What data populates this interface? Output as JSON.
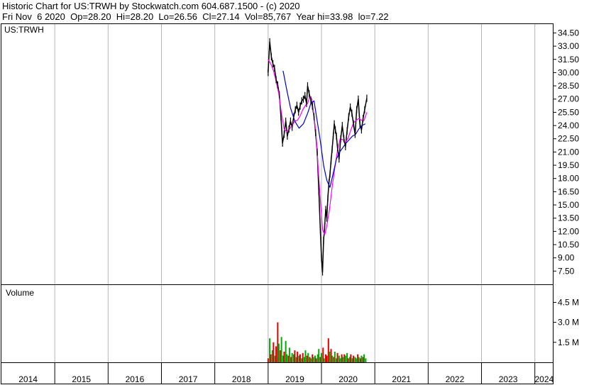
{
  "header": {
    "line1": "Historic Chart for US:TRWH by Stockwatch.com 604.687.1500 - (c) 2020",
    "line2": "Fri Nov  6 2020  Op=28.20  Hi=28.20  Lo=26.56  Cl=27.14  Vol=85,767  Year hi=33.98  lo=7.22"
  },
  "chart_data": {
    "type": "line",
    "symbol_label": "US:TRWH",
    "volume_label": "Volume",
    "price_axis": {
      "ticks": [
        "34.50",
        "33.00",
        "31.50",
        "30.00",
        "28.50",
        "27.00",
        "25.50",
        "24.00",
        "22.50",
        "21.00",
        "19.50",
        "18.00",
        "16.50",
        "15.00",
        "13.50",
        "12.00",
        "10.50",
        "9.00",
        "7.50"
      ],
      "range": [
        6.0,
        35.5
      ]
    },
    "volume_axis": {
      "ticks": [
        "4.5 M",
        "3.0 M",
        "1.5 M"
      ],
      "tick_values": [
        4.5,
        3.0,
        1.5
      ],
      "range": [
        0,
        5.8
      ]
    },
    "x_axis": {
      "years": [
        "2014",
        "2015",
        "2016",
        "2017",
        "2018",
        "2019",
        "2020",
        "2021",
        "2022",
        "2023",
        "2024"
      ],
      "range": [
        2014.0,
        2024.35
      ]
    },
    "colors": {
      "price": "#000000",
      "ma_short": "#ff00ff",
      "ma_long": "#0000cc",
      "vol_up": "#00aa00",
      "vol_down": "#dd0000",
      "frame": "#000000",
      "grid": "#b4b4b4"
    },
    "series": [
      {
        "x": [
          2019.0,
          2019.03,
          2019.06,
          2019.09,
          2019.12,
          2019.15,
          2019.18,
          2019.21,
          2019.24,
          2019.27,
          2019.3,
          2019.33,
          2019.36,
          2019.39,
          2019.42,
          2019.45,
          2019.48,
          2019.51,
          2019.54,
          2019.57,
          2019.6,
          2019.63,
          2019.66,
          2019.69,
          2019.72,
          2019.74,
          2019.77,
          2019.8,
          2019.83,
          2019.86,
          2019.89,
          2019.92,
          2019.95,
          2019.98,
          2020.0,
          2020.02,
          2020.04,
          2020.06,
          2020.08,
          2020.1,
          2020.12,
          2020.14,
          2020.16,
          2020.18,
          2020.2,
          2020.22,
          2020.24,
          2020.26,
          2020.28,
          2020.3,
          2020.33,
          2020.36,
          2020.39,
          2020.42,
          2020.45,
          2020.48,
          2020.51,
          2020.54,
          2020.57,
          2020.6,
          2020.63,
          2020.66,
          2020.69,
          2020.72,
          2020.75,
          2020.78,
          2020.81,
          2020.85
        ],
        "y": [
          30.0,
          33.5,
          31.8,
          31.0,
          30.5,
          29.2,
          28.6,
          27.5,
          25.0,
          22.0,
          23.0,
          24.5,
          22.8,
          23.6,
          24.5,
          23.8,
          25.0,
          25.8,
          26.3,
          25.5,
          26.2,
          26.8,
          27.0,
          27.4,
          26.5,
          28.5,
          27.6,
          26.9,
          26.2,
          25.0,
          23.2,
          21.0,
          16.5,
          12.0,
          9.0,
          7.4,
          11.0,
          12.5,
          14.5,
          13.5,
          15.8,
          17.5,
          18.5,
          20.0,
          21.3,
          22.8,
          24.2,
          23.5,
          22.8,
          21.5,
          20.2,
          22.5,
          24.0,
          22.5,
          21.6,
          23.4,
          25.0,
          26.1,
          25.4,
          24.2,
          23.0,
          25.8,
          27.0,
          24.2,
          23.5,
          24.8,
          25.8,
          27.1
        ]
      },
      {
        "name": "",
        "x": [
          2019.0,
          2019.05,
          2019.1,
          2019.15,
          2019.2,
          2019.25,
          2019.3,
          2019.35,
          2019.4,
          2019.45,
          2019.5,
          2019.55,
          2019.6,
          2019.65,
          2019.7,
          2019.74,
          2019.78,
          2019.82,
          2019.86,
          2019.9,
          2019.94,
          2019.98,
          2020.02,
          2020.06,
          2020.1,
          2020.15,
          2020.2,
          2020.25,
          2020.3,
          2020.35,
          2020.4,
          2020.45,
          2020.5,
          2020.55,
          2020.6,
          2020.65,
          2020.7,
          2020.75,
          2020.8,
          2020.85
        ],
        "y": [
          31.5,
          31.0,
          30.2,
          29.0,
          27.6,
          25.4,
          23.6,
          23.3,
          23.6,
          24.0,
          24.5,
          24.6,
          25.1,
          25.8,
          26.3,
          26.5,
          27.3,
          27.0,
          25.0,
          22.8,
          19.0,
          15.5,
          12.2,
          11.6,
          12.6,
          14.5,
          17.0,
          19.2,
          21.2,
          22.5,
          22.4,
          22.1,
          22.6,
          23.5,
          24.3,
          24.6,
          24.8,
          24.6,
          24.6,
          25.5
        ]
      },
      {
        "name": "",
        "x": [
          2019.28,
          2019.35,
          2019.42,
          2019.5,
          2019.58,
          2019.66,
          2019.74,
          2019.8,
          2019.86,
          2019.92,
          2019.98,
          2020.04,
          2020.1,
          2020.16,
          2020.22,
          2020.28,
          2020.34,
          2020.4,
          2020.46,
          2020.52,
          2020.58,
          2020.64,
          2020.7,
          2020.76,
          2020.82
        ],
        "y": [
          30.2,
          28.0,
          26.0,
          24.5,
          23.7,
          24.2,
          25.4,
          26.5,
          26.8,
          24.5,
          22.2,
          19.5,
          17.8,
          17.0,
          18.6,
          20.2,
          21.0,
          21.5,
          22.0,
          22.4,
          22.8,
          23.0,
          23.6,
          24.0,
          24.2
        ]
      }
    ],
    "volume": {
      "x": [
        2019.0,
        2019.03,
        2019.05,
        2019.08,
        2019.1,
        2019.13,
        2019.15,
        2019.18,
        2019.2,
        2019.23,
        2019.25,
        2019.28,
        2019.3,
        2019.33,
        2019.35,
        2019.38,
        2019.4,
        2019.43,
        2019.45,
        2019.48,
        2019.5,
        2019.53,
        2019.55,
        2019.58,
        2019.6,
        2019.63,
        2019.65,
        2019.68,
        2019.7,
        2019.73,
        2019.75,
        2019.78,
        2019.8,
        2019.83,
        2019.85,
        2019.88,
        2019.9,
        2019.93,
        2019.95,
        2019.98,
        2020.0,
        2020.03,
        2020.05,
        2020.08,
        2020.1,
        2020.13,
        2020.15,
        2020.18,
        2020.2,
        2020.23,
        2020.25,
        2020.28,
        2020.3,
        2020.33,
        2020.35,
        2020.38,
        2020.4,
        2020.43,
        2020.45,
        2020.48,
        2020.5,
        2020.53,
        2020.55,
        2020.58,
        2020.6,
        2020.63,
        2020.65,
        2020.68,
        2020.7,
        2020.73,
        2020.75,
        2020.78,
        2020.8,
        2020.83
      ],
      "values": [
        0.3,
        1.8,
        0.6,
        0.9,
        1.5,
        0.5,
        1.2,
        3.0,
        1.4,
        0.9,
        1.9,
        0.5,
        0.8,
        1.6,
        0.6,
        0.5,
        1.1,
        0.4,
        0.7,
        0.6,
        0.9,
        0.4,
        0.8,
        0.5,
        0.6,
        0.3,
        0.7,
        0.4,
        0.9,
        0.5,
        0.7,
        0.4,
        0.3,
        0.6,
        0.4,
        0.5,
        0.3,
        0.6,
        1.0,
        0.4,
        0.7,
        1.1,
        0.3,
        0.6,
        0.5,
        1.8,
        0.8,
        1.0,
        0.5,
        0.4,
        0.8,
        0.3,
        0.7,
        0.5,
        0.3,
        0.6,
        0.4,
        0.6,
        0.5,
        0.7,
        0.3,
        0.4,
        0.6,
        0.3,
        0.5,
        0.4,
        0.3,
        0.6,
        0.4,
        0.3,
        0.5,
        0.4,
        0.6,
        0.3
      ],
      "up": [
        false,
        true,
        false,
        true,
        false,
        true,
        false,
        false,
        true,
        false,
        true,
        true,
        false,
        true,
        true,
        false,
        true,
        false,
        true,
        true,
        false,
        true,
        false,
        true,
        false,
        true,
        false,
        true,
        true,
        false,
        true,
        false,
        true,
        false,
        true,
        true,
        false,
        true,
        true,
        false,
        true,
        false,
        true,
        false,
        false,
        false,
        true,
        false,
        true,
        false,
        true,
        true,
        false,
        true,
        true,
        false,
        true,
        false,
        true,
        true,
        false,
        true,
        false,
        true,
        false,
        true,
        true,
        false,
        true,
        false,
        true,
        false,
        true,
        true
      ]
    }
  }
}
